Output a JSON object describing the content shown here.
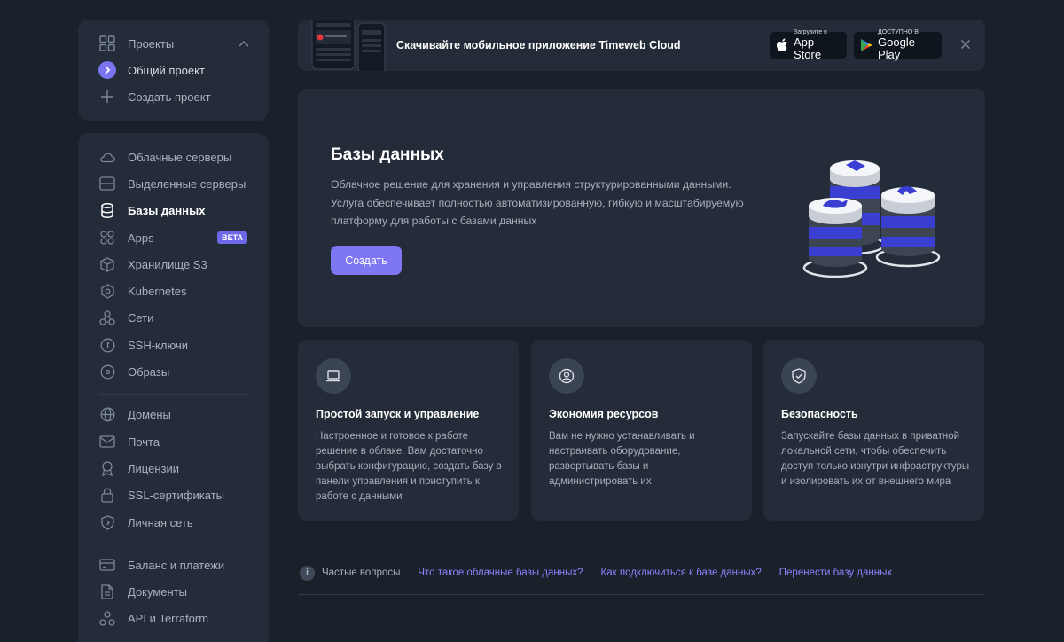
{
  "sidebar": {
    "projects": {
      "header": "Проекты",
      "items": [
        {
          "label": "Общий проект",
          "active": true
        },
        {
          "label": "Создать проект"
        }
      ]
    },
    "nav": [
      {
        "label": "Облачные серверы",
        "icon": "cloud-icon"
      },
      {
        "label": "Выделенные серверы",
        "icon": "server-icon"
      },
      {
        "label": "Базы данных",
        "icon": "database-icon",
        "active": true
      },
      {
        "label": "Apps",
        "icon": "apps-grid-icon",
        "badge": "BETA"
      },
      {
        "label": "Хранилище S3",
        "icon": "cube-icon"
      },
      {
        "label": "Kubernetes",
        "icon": "kubernetes-icon"
      },
      {
        "label": "Сети",
        "icon": "network-icon"
      },
      {
        "label": "SSH-ключи",
        "icon": "key-icon"
      },
      {
        "label": "Образы",
        "icon": "disk-image-icon"
      },
      {
        "label": "Домены",
        "icon": "globe-icon"
      },
      {
        "label": "Почта",
        "icon": "mail-icon"
      },
      {
        "label": "Лицензии",
        "icon": "license-icon"
      },
      {
        "label": "SSL-сертификаты",
        "icon": "lock-icon"
      },
      {
        "label": "Личная сеть",
        "icon": "shield-icon"
      },
      {
        "label": "Баланс и платежи",
        "icon": "wallet-icon"
      },
      {
        "label": "Документы",
        "icon": "document-icon"
      },
      {
        "label": "API и Terraform",
        "icon": "api-icon"
      }
    ]
  },
  "banner": {
    "text": "Скачивайте мобильное приложение Timeweb Cloud",
    "appstore": {
      "small": "Загрузите в",
      "big": "App Store"
    },
    "googleplay": {
      "small": "ДОСТУПНО В",
      "big": "Google Play"
    }
  },
  "hero": {
    "title": "Базы данных",
    "description": "Облачное решение для хранения и управления структурированными данными. Услуга обеспечивает полностью автоматизированную, гибкую и масштабируемую платформу для работы с базами данных",
    "button": "Создать"
  },
  "features": [
    {
      "title": "Простой запуск и управление",
      "text": "Настроенное и готовое к работе решение в облаке. Вам достаточно выбрать конфигурацию, создать базу в панели управления и приступить к работе с данными",
      "icon": "laptop-icon"
    },
    {
      "title": "Экономия ресурсов",
      "text": "Вам не нужно устанавливать и настраивать оборудование, развертывать базы и администрировать их",
      "icon": "user-circle-icon"
    },
    {
      "title": "Безопасность",
      "text": "Запускайте базы данных в приватной локальной сети, чтобы обеспечить доступ только изнутри инфраструктуры и изолировать их от внешнего мира",
      "icon": "shield-check-icon"
    }
  ],
  "faq": {
    "label": "Частые вопросы",
    "links": [
      "Что такое облачные базы данных?",
      "Как подключиться к базе данных?",
      "Перенести базу данных"
    ]
  },
  "colors": {
    "accent": "#7e76f2",
    "link": "#8a84ff",
    "background": "#1a212b",
    "panel": "#232c38"
  }
}
